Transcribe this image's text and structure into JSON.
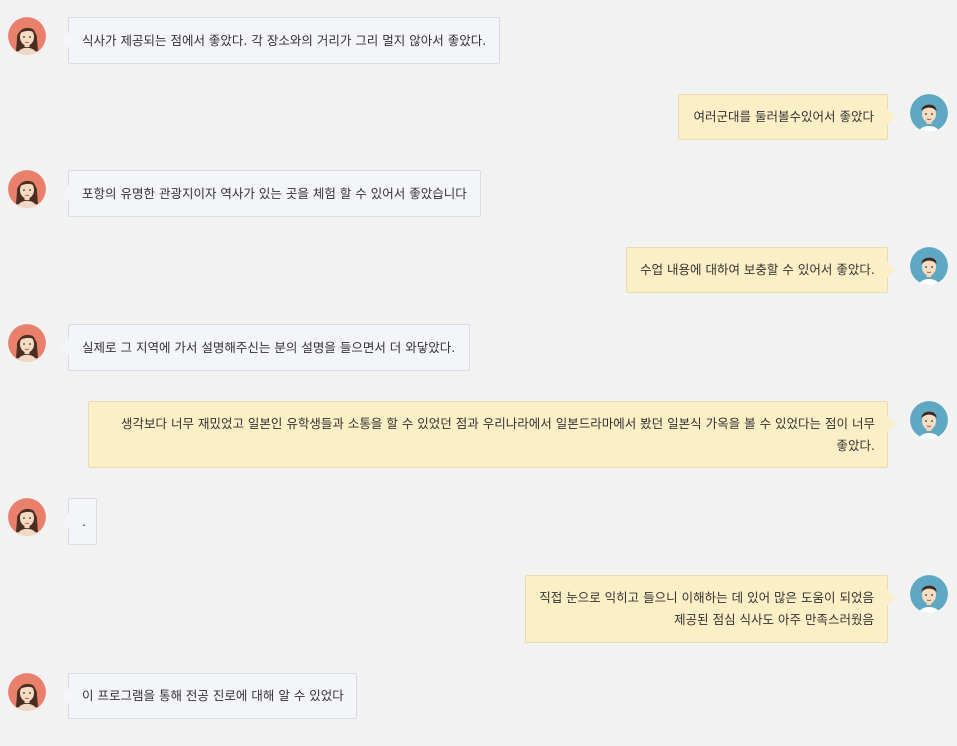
{
  "messages": [
    {
      "side": "left",
      "avatar": "female-avatar-icon",
      "lines": [
        "식사가 제공되는 점에서 좋았다. 각 장소와의 거리가 그리 멀지 않아서 좋았다."
      ]
    },
    {
      "side": "right",
      "avatar": "male-avatar-icon",
      "lines": [
        "여러군대를 둘러볼수있어서 좋았다"
      ]
    },
    {
      "side": "left",
      "avatar": "female-avatar-icon",
      "lines": [
        "포항의 유명한 관광지이자 역사가 있는 곳을 체험 할 수 있어서 좋았습니다"
      ]
    },
    {
      "side": "right",
      "avatar": "male-avatar-icon",
      "lines": [
        "수업 내용에 대하여 보충할 수 있어서 좋았다."
      ]
    },
    {
      "side": "left",
      "avatar": "female-avatar-icon",
      "lines": [
        "실제로 그 지역에 가서 설명해주신는 분의 설명을 들으면서 더 와닿았다."
      ]
    },
    {
      "side": "right",
      "avatar": "male-avatar-icon",
      "lines": [
        "생각보다 너무 재밌었고 일본인 유학생들과 소통을 할 수 있었던 점과 우리나라에서 일본드라마에서 봤던 일본식 가옥을 볼 수 있었다는 점이 너무 좋았다."
      ]
    },
    {
      "side": "left",
      "avatar": "female-avatar-icon",
      "lines": [
        "."
      ]
    },
    {
      "side": "right",
      "avatar": "male-avatar-icon",
      "lines": [
        "직접 눈으로 익히고 들으니 이해하는 데 있어 많은 도움이 되었음",
        "제공된 점심 식사도 아주 만족스러웠음"
      ]
    },
    {
      "side": "left",
      "avatar": "female-avatar-icon",
      "lines": [
        "이 프로그램을 통해 전공 진로에 대해 알 수 있었다"
      ]
    }
  ],
  "colors": {
    "background": "#f2f2f3",
    "left_bubble": "#f4f5f8",
    "right_bubble": "#fcefc6",
    "female_avatar_bg": "#e8806b",
    "male_avatar_bg": "#5fa8c4"
  }
}
